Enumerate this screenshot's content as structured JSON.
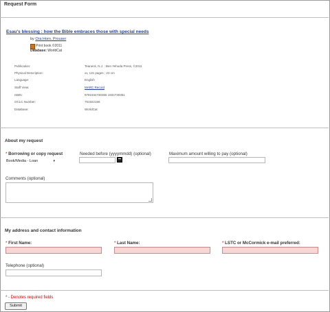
{
  "header": {
    "title": "Request Form"
  },
  "book": {
    "title": "Esau's blessing : how the Bible embraces those with special needs",
    "by_prefix": "by",
    "author": "Ora Horn. Prouser",
    "format": "Print book ©2011",
    "database_label": "Database:",
    "database_value": "WorldCat"
  },
  "details": [
    {
      "label": "Publication:",
      "value": "Teaneck, N.J. : Ben Yehuda Press, ©2011"
    },
    {
      "label": "Physical Description:",
      "value": "xv, 131 pages ; 23 cm"
    },
    {
      "label": "Language:",
      "value": "English"
    },
    {
      "label": "Staff View:",
      "value": "MARC Record"
    },
    {
      "label": "ISBN:",
      "value": "9781934730355 1934730351"
    },
    {
      "label": "OCLC Number:",
      "value": "751922166"
    },
    {
      "label": "Database:",
      "value": "WorldCat"
    }
  ],
  "about": {
    "title": "About my request",
    "borrowing_label": "Borrowing or copy request",
    "borrowing_value": "Book/Media - Loan",
    "needed_label": "Needed before (yyyymmdd) (optional)",
    "needed_value": "",
    "max_label": "Maximum amount willing to pay (optional)",
    "max_value": "",
    "comments_label": "Comments (optional)",
    "comments_value": ""
  },
  "contact": {
    "title": "My address and contact information",
    "first_name_label": "First Name:",
    "last_name_label": "Last Name:",
    "email_label": "LSTC or McCormick e-mail preferred:",
    "telephone_label": "Telephone (optional)",
    "first_name_value": "",
    "last_name_value": "",
    "email_value": "",
    "telephone_value": ""
  },
  "footer": {
    "required_note": "* - Denotes required fields",
    "submit_label": "Submit"
  },
  "symbols": {
    "required_star": "*",
    "dropdown_arrow": "▾"
  },
  "colors": {
    "link": "#1a3ea8",
    "required": "#cc0000",
    "required_field_bg": "#f7d6d6"
  }
}
